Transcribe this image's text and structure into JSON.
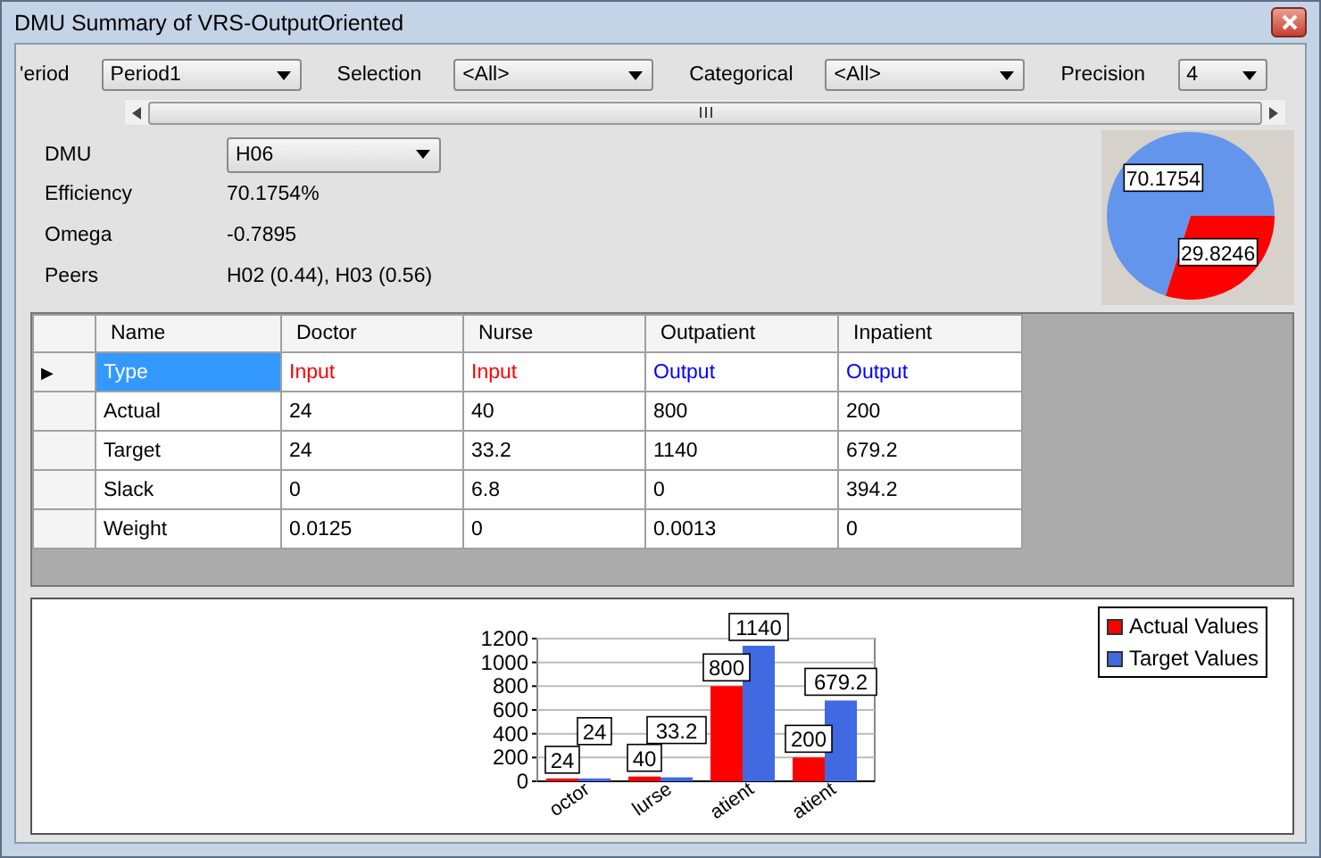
{
  "window": {
    "title": "DMU Summary of VRS-OutputOriented"
  },
  "filters": [
    {
      "label": "'eriod",
      "value": "Period1"
    },
    {
      "label": "Selection",
      "value": "<All>"
    },
    {
      "label": "Categorical",
      "value": "<All>"
    },
    {
      "label": "Precision",
      "value": "4"
    }
  ],
  "dmu": {
    "label": "DMU",
    "value": "H06"
  },
  "stats": [
    {
      "label": "Efficiency",
      "value": "70.1754%"
    },
    {
      "label": "Omega",
      "value": "-0.7895"
    },
    {
      "label": "Peers",
      "value": "H02 (0.44), H03 (0.56)"
    }
  ],
  "pie": {
    "chart_data": {
      "type": "pie",
      "values": [
        70.1754,
        29.8246
      ],
      "colors": [
        "#6495ed",
        "#ff0000"
      ],
      "data_labels": true
    }
  },
  "table": {
    "columns": [
      "Name",
      "Doctor",
      "Nurse",
      "Outpatient",
      "Inpatient"
    ],
    "current_marker": "▶",
    "rows": [
      {
        "current": true,
        "cells": [
          {
            "text": "Type",
            "selected": true,
            "kind": "plain"
          },
          {
            "text": "Input",
            "selected": false,
            "kind": "input"
          },
          {
            "text": "Input",
            "selected": false,
            "kind": "input"
          },
          {
            "text": "Output",
            "selected": false,
            "kind": "output"
          },
          {
            "text": "Output",
            "selected": false,
            "kind": "output"
          }
        ]
      },
      {
        "current": false,
        "cells": [
          {
            "text": "Actual",
            "selected": false,
            "kind": "plain"
          },
          {
            "text": "24",
            "selected": false,
            "kind": "plain"
          },
          {
            "text": "40",
            "selected": false,
            "kind": "plain"
          },
          {
            "text": "800",
            "selected": false,
            "kind": "plain"
          },
          {
            "text": "200",
            "selected": false,
            "kind": "plain"
          }
        ]
      },
      {
        "current": false,
        "cells": [
          {
            "text": "Target",
            "selected": false,
            "kind": "plain"
          },
          {
            "text": "24",
            "selected": false,
            "kind": "plain"
          },
          {
            "text": "33.2",
            "selected": false,
            "kind": "plain"
          },
          {
            "text": "1140",
            "selected": false,
            "kind": "plain"
          },
          {
            "text": "679.2",
            "selected": false,
            "kind": "plain"
          }
        ]
      },
      {
        "current": false,
        "cells": [
          {
            "text": "Slack",
            "selected": false,
            "kind": "plain"
          },
          {
            "text": "0",
            "selected": false,
            "kind": "plain"
          },
          {
            "text": "6.8",
            "selected": false,
            "kind": "plain"
          },
          {
            "text": "0",
            "selected": false,
            "kind": "plain"
          },
          {
            "text": "394.2",
            "selected": false,
            "kind": "plain"
          }
        ]
      },
      {
        "current": false,
        "cells": [
          {
            "text": "Weight",
            "selected": false,
            "kind": "plain"
          },
          {
            "text": "0.0125",
            "selected": false,
            "kind": "plain"
          },
          {
            "text": "0",
            "selected": false,
            "kind": "plain"
          },
          {
            "text": "0.0013",
            "selected": false,
            "kind": "plain"
          },
          {
            "text": "0",
            "selected": false,
            "kind": "plain"
          }
        ]
      }
    ]
  },
  "bar_chart": {
    "chart_data": {
      "type": "bar",
      "categories": [
        "octor",
        "lurse",
        "atient",
        "atient"
      ],
      "series": [
        {
          "name": "Actual Values",
          "color": "#ff0000",
          "values": [
            24,
            40,
            800,
            200
          ]
        },
        {
          "name": "Target Values",
          "color": "#4169e1",
          "values": [
            24,
            33.2,
            1140,
            679.2
          ]
        }
      ],
      "ylim": [
        0,
        1200
      ],
      "yticks": [
        0,
        200,
        400,
        600,
        800,
        1000,
        1200
      ],
      "grid": true,
      "data_labels": true
    }
  }
}
